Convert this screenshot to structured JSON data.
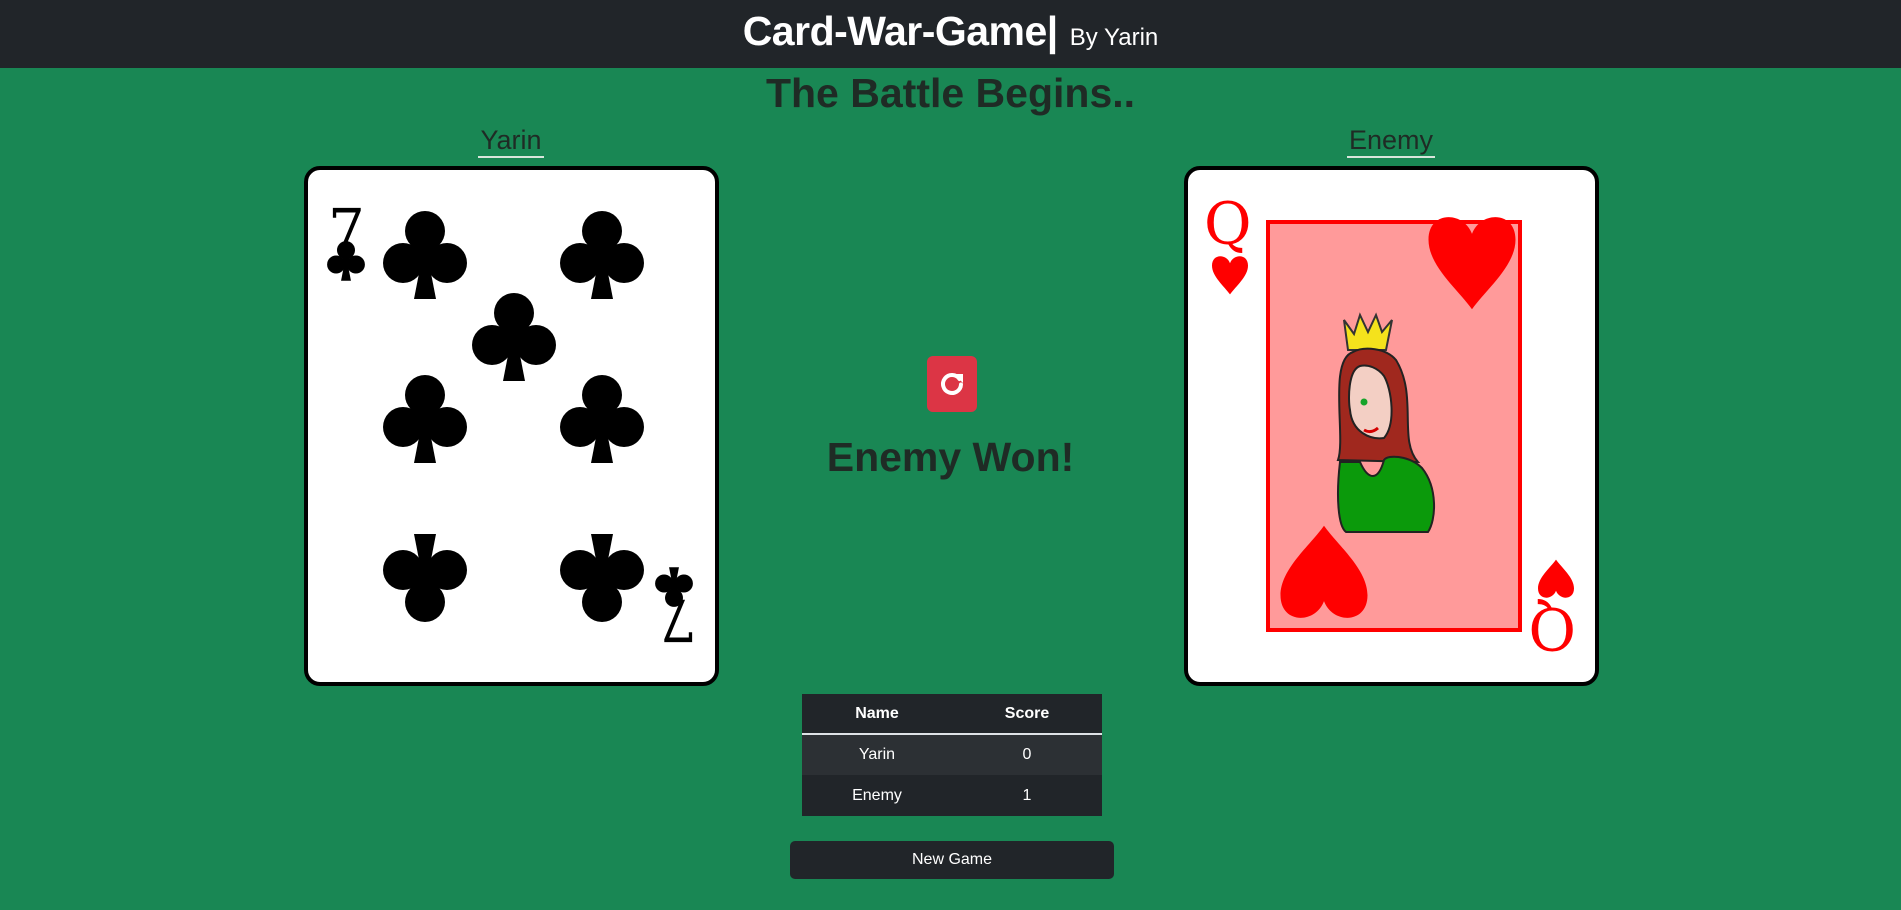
{
  "header": {
    "title": "Card-War-Game|",
    "byline": "By Yarin"
  },
  "subtitle": "The Battle Begins..",
  "players": {
    "left": {
      "name": "Yarin",
      "card": {
        "rank": "7",
        "suit": "clubs"
      }
    },
    "right": {
      "name": "Enemy",
      "card": {
        "rank": "Q",
        "suit": "hearts"
      }
    }
  },
  "refresh_icon": "refresh-icon",
  "result": "Enemy Won!",
  "scoreboard": {
    "headers": [
      "Name",
      "Score"
    ],
    "rows": [
      {
        "name": "Yarin",
        "score": "0"
      },
      {
        "name": "Enemy",
        "score": "1"
      }
    ]
  },
  "new_game_label": "New Game",
  "colors": {
    "table": "#198754",
    "topbar": "#212529",
    "danger": "#dc3545",
    "hearts": "#ff0000",
    "clubs": "#000000"
  }
}
